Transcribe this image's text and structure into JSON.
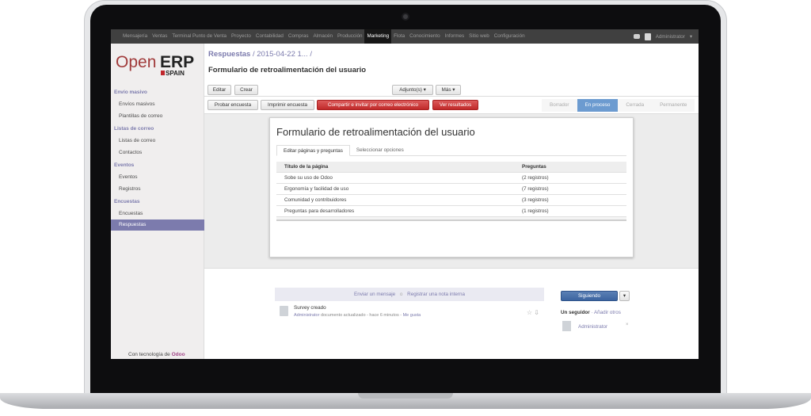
{
  "topbar": {
    "menu": [
      "Mensajería",
      "Ventas",
      "Terminal Punto de Venta",
      "Proyecto",
      "Contabilidad",
      "Compras",
      "Almacén",
      "Producción",
      "Marketing",
      "Flota",
      "Conocimiento",
      "Informes",
      "Sitio web",
      "Configuración"
    ],
    "active_menu": "Marketing",
    "user": "Administrator"
  },
  "logo": {
    "open": "Open",
    "erp": "ERP",
    "country": "SPAIN"
  },
  "sidebar": {
    "sections": [
      {
        "title": "Envío masivo",
        "items": [
          "Envíos masivos",
          "Plantillas de correo"
        ]
      },
      {
        "title": "Listas de correo",
        "items": [
          "Listas de correo",
          "Contactos"
        ]
      },
      {
        "title": "Eventos",
        "items": [
          "Eventos",
          "Registros"
        ]
      },
      {
        "title": "Encuestas",
        "items": [
          "Encuestas",
          "Respuestas"
        ]
      }
    ],
    "active_item": "Respuestas",
    "powered_prefix": "Con tecnología de",
    "powered_brand": "Odoo"
  },
  "breadcrumb": {
    "root": "Respuestas",
    "rest": "/ 2015-04-22 1... /"
  },
  "page_title": "Formulario de retroalimentación del usuario",
  "buttons": {
    "edit": "Editar",
    "create": "Crear",
    "attachments": "Adjunto(s) ▾",
    "more": "Más ▾",
    "test": "Probar encuesta",
    "print": "Imprimir encuesta",
    "share": "Compartir e invitar por correo electrónico",
    "results": "Ver resultados"
  },
  "status_steps": [
    "Borrador",
    "En proceso",
    "Cerrada",
    "Permanente"
  ],
  "status_active": "En proceso",
  "form": {
    "title": "Formulario de retroalimentación del usuario",
    "tabs": [
      "Editar páginas y preguntas",
      "Seleccionar opciones"
    ],
    "columns": [
      "Título de la página",
      "Preguntas"
    ],
    "rows": [
      [
        "Sobe su uso de Odoo",
        "(2 registros)"
      ],
      [
        "Ergonomía y facilidad de uso",
        "(7 registros)"
      ],
      [
        "Comunidad y contribuidores",
        "(3 registros)"
      ],
      [
        "Preguntas para desarrolladores",
        "(1 registros)"
      ]
    ]
  },
  "chatter": {
    "send_message": "Enviar un mensaje",
    "log_note": "Registrar una nota interna",
    "message_title": "Survey creado",
    "message_author": "Administrator",
    "message_text": "documento actualizado - hace 6 minutos -",
    "message_like": "Me gusta"
  },
  "followers": {
    "following_label": "Siguiendo",
    "count_label": "Un seguidor",
    "add_label": "· Añadir otros",
    "follower_name": "Administrator"
  }
}
